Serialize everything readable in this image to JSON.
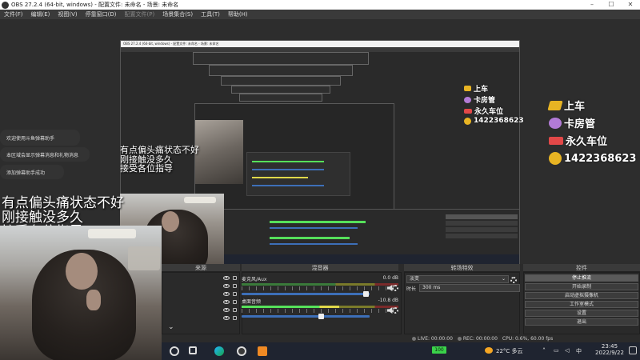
{
  "window": {
    "title": "OBS 27.2.4 (64-bit, windows) - 配置文件: 未命名 - 场景: 未命名",
    "minimize": "–",
    "maximize": "☐",
    "close": "✕"
  },
  "menu": [
    {
      "label": "文件(F)",
      "enabled": true
    },
    {
      "label": "编辑(E)",
      "enabled": true
    },
    {
      "label": "视图(V)",
      "enabled": true
    },
    {
      "label": "停靠窗口(D)",
      "enabled": true
    },
    {
      "label": "配置文件(P)",
      "enabled": false
    },
    {
      "label": "场景集合(S)",
      "enabled": true
    },
    {
      "label": "工具(T)",
      "enabled": true
    },
    {
      "label": "帮助(H)",
      "enabled": true
    }
  ],
  "nested": {
    "title": "OBS 27.2.4 (64-bit, windows) - 配置文件: 未命名 - 场景: 未命名"
  },
  "badges": [
    {
      "text": "上车",
      "color": "#e8b423",
      "size": "large"
    },
    {
      "text": "卡房管",
      "color": "#b27bd6",
      "size": "large"
    },
    {
      "text": "永久车位",
      "color": "#e24848",
      "size": "large"
    },
    {
      "text": "1422368623",
      "color": "#e8b423",
      "size": "large"
    }
  ],
  "notifications": [
    "欢迎使用斗鱼弹幕助手",
    "本区域会显示弹幕消息和礼物消息",
    "添加弹幕助手成功"
  ],
  "overlay_text": {
    "line1": "有点偏头痛状态不好",
    "line2": "刚接触没多久",
    "line3": "接受各位指导"
  },
  "dock": {
    "sources_title": "来源",
    "mixer_title": "混音器",
    "transitions_title": "转场特效",
    "controls_title": "控件"
  },
  "mixer": {
    "channels": [
      {
        "name": "麦克风/Aux",
        "db": "0.0 dB",
        "level": 0.0,
        "volume": 0.95
      },
      {
        "name": "桌面音频",
        "db": "-10.8 dB",
        "level": 0.62,
        "volume": 0.6
      }
    ]
  },
  "transitions": {
    "selected": "淡变",
    "duration_label": "时长",
    "duration_value": "300 ms"
  },
  "controls": [
    {
      "label": "停止推流",
      "active": true
    },
    {
      "label": "开始录制",
      "active": false
    },
    {
      "label": "启动虚拟摄像机",
      "active": false
    },
    {
      "label": "工作室模式",
      "active": false
    },
    {
      "label": "设置",
      "active": false
    },
    {
      "label": "退出",
      "active": false
    }
  ],
  "status": {
    "live": "LIVE: 00:00:00",
    "rec": "REC: 00:00:00",
    "cpu": "CPU: 0.6%, 60.00 fps"
  },
  "taskbar": {
    "weather": "22°C 多云",
    "time": "23:45",
    "date": "2022/9/22",
    "battery": "100"
  },
  "icons": {
    "scroll_down": "chevron-down-icon"
  }
}
